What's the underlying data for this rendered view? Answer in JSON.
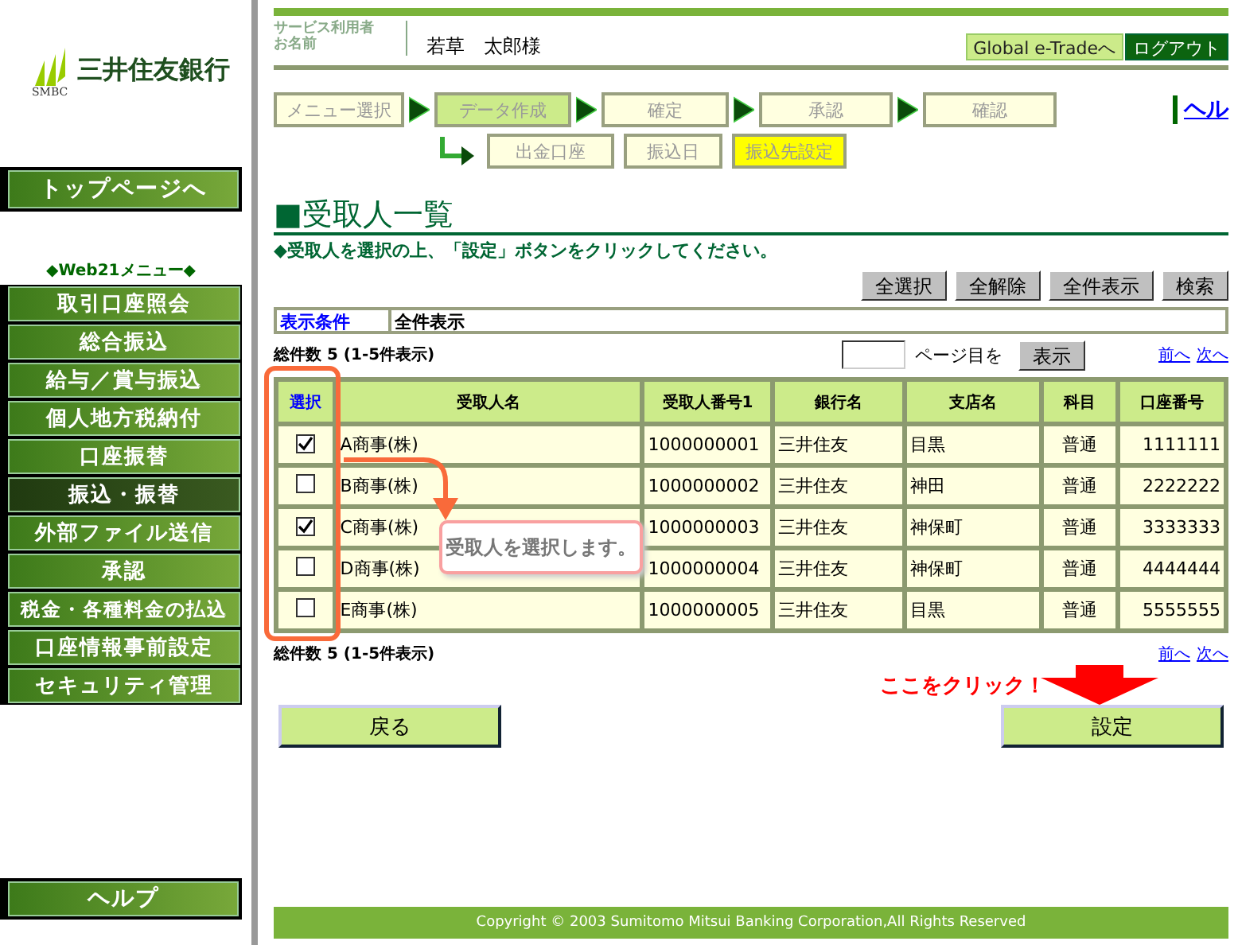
{
  "sidebar": {
    "bank_name": "三井住友銀行",
    "logo_caption": "SMBC",
    "top_button": "トップページへ",
    "menu_title": "◆Web21メニュー◆",
    "menu_items": [
      {
        "label": "取引口座照会",
        "selected": false
      },
      {
        "label": "総合振込",
        "selected": false
      },
      {
        "label": "給与／賞与振込",
        "selected": false
      },
      {
        "label": "個人地方税納付",
        "selected": false
      },
      {
        "label": "口座振替",
        "selected": false
      },
      {
        "label": "振込・振替",
        "selected": true
      },
      {
        "label": "外部ファイル送信",
        "selected": false
      },
      {
        "label": "承認",
        "selected": false
      },
      {
        "label": "税金・各種料金の払込",
        "selected": false
      },
      {
        "label": "口座情報事前設定",
        "selected": false
      },
      {
        "label": "セキュリティ管理",
        "selected": false
      }
    ],
    "help_button": "ヘルプ"
  },
  "header": {
    "user_label_1": "サービス利用者",
    "user_label_2": "お名前",
    "user_name": "若草　太郎様",
    "global_button": "Global e-Tradeへ",
    "logout_button": "ログアウト"
  },
  "steps": [
    {
      "label": "メニュー選択",
      "selected": false
    },
    {
      "label": "データ作成",
      "selected": true
    },
    {
      "label": "確定",
      "selected": false
    },
    {
      "label": "承認",
      "selected": false
    },
    {
      "label": "確認",
      "selected": false
    }
  ],
  "help_link": "ヘル",
  "substeps": [
    {
      "label": "出金口座",
      "selected": false
    },
    {
      "label": "振込日",
      "selected": false
    },
    {
      "label": "振込先設定",
      "selected": true
    }
  ],
  "title": "■受取人一覧",
  "instruction": "◆受取人を選択の上、「設定」ボタンをクリックしてください。",
  "action_buttons": [
    "全選択",
    "全解除",
    "全件表示",
    "検索"
  ],
  "filter": {
    "label": "表示条件",
    "value": "全件表示"
  },
  "total_top": "総件数 5 (1-5件表示)",
  "pager": {
    "page_suffix": "ページ目を",
    "show_button": "表示",
    "prev": "前へ",
    "next": "次へ"
  },
  "table": {
    "columns": [
      "選択",
      "受取人名",
      "受取人番号1",
      "銀行名",
      "支店名",
      "科目",
      "口座番号"
    ],
    "rows": [
      {
        "checked": true,
        "cells": [
          "",
          "A商事(株)",
          "1000000001",
          "三井住友",
          "目黒",
          "普通",
          "1111111"
        ]
      },
      {
        "checked": false,
        "cells": [
          "",
          "B商事(株)",
          "1000000002",
          "三井住友",
          "神田",
          "普通",
          "2222222"
        ]
      },
      {
        "checked": true,
        "cells": [
          "",
          "C商事(株)",
          "1000000003",
          "三井住友",
          "神保町",
          "普通",
          "3333333"
        ]
      },
      {
        "checked": false,
        "cells": [
          "",
          "D商事(株)",
          "1000000004",
          "三井住友",
          "神保町",
          "普通",
          "4444444"
        ]
      },
      {
        "checked": false,
        "cells": [
          "",
          "E商事(株)",
          "1000000005",
          "三井住友",
          "目黒",
          "普通",
          "5555555"
        ]
      }
    ]
  },
  "total_bottom": "総件数 5 (1-5件表示)",
  "pager_bottom": {
    "prev": "前へ",
    "next": "次へ"
  },
  "callout": "受取人を選択します。",
  "click_hint": "ここをクリック！",
  "back_button": "戻る",
  "set_button": "設定",
  "footer": "Copyright © 2003 Sumitomo Mitsui Banking Corporation,All Rights Reserved"
}
